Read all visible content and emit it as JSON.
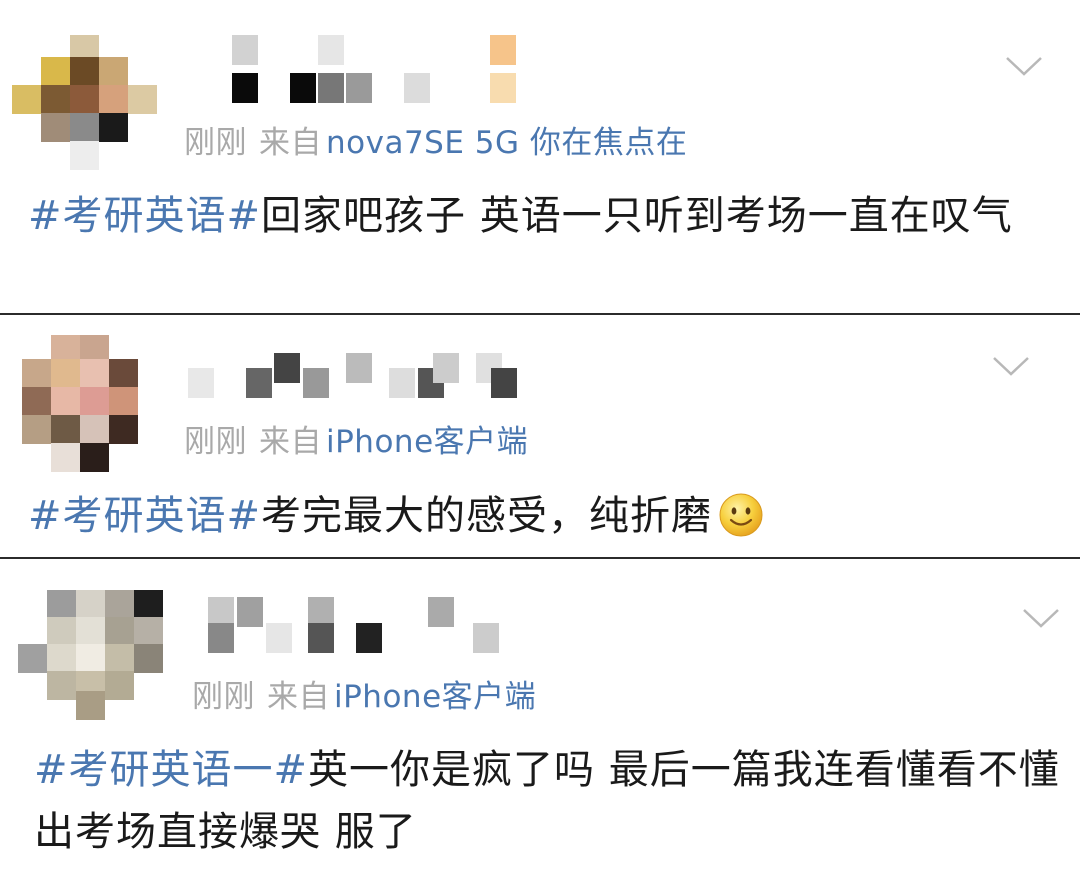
{
  "posts": [
    {
      "time": "刚刚",
      "from": "来自",
      "source": "nova7SE 5G 你在焦点在",
      "hashtag": "#考研英语#",
      "text": "回家吧孩子 英语一只听到考场一直在叹气"
    },
    {
      "time": "刚刚",
      "from": "来自",
      "source": "iPhone客户端",
      "hashtag": "#考研英语#",
      "text": "考完最大的感受，纯折磨"
    },
    {
      "time": "刚刚",
      "from": "来自",
      "source": "iPhone客户端",
      "hashtag": "#考研英语一#",
      "text": "英一你是疯了吗 最后一篇我连看懂看不懂 出考场直接爆哭 服了"
    }
  ],
  "icons": {
    "menu": "chevron-down-icon",
    "emoji": "smile-emoji-icon"
  },
  "colors": {
    "link": "#4a77b0",
    "meta": "#a9a9a9",
    "text": "#1a1a1a",
    "divider": "#2b2b2b"
  }
}
